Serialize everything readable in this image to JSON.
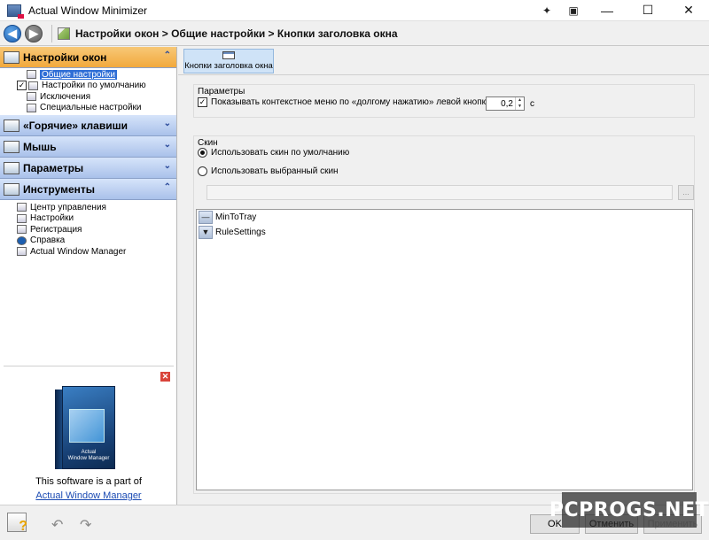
{
  "window": {
    "title": "Actual Window Minimizer"
  },
  "navbar": {
    "breadcrumb": "Настройки окон > Общие настройки > Кнопки заголовка окна"
  },
  "sidebar": {
    "sections": [
      {
        "label": "Настройки окон",
        "icon": "window-settings-icon",
        "expanded": true,
        "items": [
          {
            "label": "Общие настройки",
            "selected": true
          },
          {
            "label": "Настройки по умолчанию",
            "checked": true
          },
          {
            "label": "Исключения"
          },
          {
            "label": "Специальные настройки"
          }
        ]
      },
      {
        "label": "«Горячие» клавиши",
        "icon": "hotkeys-icon",
        "expanded": false
      },
      {
        "label": "Мышь",
        "icon": "mouse-icon",
        "expanded": false
      },
      {
        "label": "Параметры",
        "icon": "options-icon",
        "expanded": false
      },
      {
        "label": "Инструменты",
        "icon": "tools-icon",
        "expanded": true,
        "items": [
          {
            "label": "Центр управления"
          },
          {
            "label": "Настройки"
          },
          {
            "label": "Регистрация"
          },
          {
            "label": "Справка"
          },
          {
            "label": "Actual Window Manager"
          }
        ]
      }
    ],
    "ad": {
      "box_title": "Actual",
      "box_subtitle": "Window Manager",
      "text": "This software is a part of",
      "link": "Actual Window Manager"
    }
  },
  "tab": {
    "label": "Кнопки заголовка окна"
  },
  "params": {
    "title": "Параметры",
    "context_menu_checked": true,
    "context_menu_label": "Показывать контекстное меню по «долгому нажатию» левой кнопки мыши",
    "delay_value": "0,2",
    "delay_unit": "с"
  },
  "skin": {
    "title": "Скин",
    "default_label": "Использовать скин по умолчанию",
    "custom_label": "Использовать выбранный скин",
    "selected": "default",
    "browse_label": "...",
    "items": [
      {
        "label": "MinToTray",
        "icon": "min-to-tray-icon",
        "glyph": "—"
      },
      {
        "label": "RuleSettings",
        "icon": "rule-settings-icon",
        "glyph": "▼"
      }
    ]
  },
  "footer": {
    "ok_label": "OK",
    "cancel_label": "Отменить",
    "apply_label": "Применить"
  },
  "watermark": {
    "text": "PCPROGS.NET"
  }
}
